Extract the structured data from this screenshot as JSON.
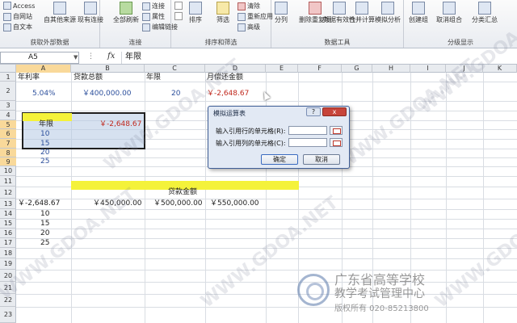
{
  "ribbon": {
    "get_external": {
      "label": "获取外部数据",
      "items": [
        "Access",
        "自网站",
        "自文本",
        "自其他来源",
        "现有连接"
      ]
    },
    "connections": {
      "label": "连接",
      "items": [
        "全部刷新",
        "连接",
        "属性",
        "编辑链接"
      ]
    },
    "sort_filter": {
      "label": "排序和筛选",
      "items": [
        "排序",
        "筛选",
        "清除",
        "重新应用",
        "高级"
      ]
    },
    "data_tools": {
      "label": "数据工具",
      "items": [
        "分列",
        "删除重复项",
        "数据有效性",
        "合并计算",
        "模拟分析"
      ]
    },
    "outline": {
      "label": "分级显示",
      "items": [
        "创建组",
        "取消组合",
        "分类汇总"
      ]
    }
  },
  "formula_bar": {
    "name_box": "A5",
    "fx": "fx",
    "content": "年限"
  },
  "columns": [
    "A",
    "B",
    "C",
    "D",
    "E",
    "F",
    "G",
    "H",
    "I",
    "J",
    "K"
  ],
  "rows": [
    "1",
    "2",
    "3",
    "4",
    "5",
    "6",
    "7",
    "8",
    "9",
    "10",
    "11",
    "12",
    "13",
    "14",
    "15",
    "16",
    "17",
    "18",
    "19",
    "20",
    "21",
    "22",
    "23"
  ],
  "sheet": {
    "a1": "年利率",
    "b1": "贷款总额",
    "c1": "年限",
    "d1": "月偿还金额",
    "a2": "5.04%",
    "b2": "￥400,000.00",
    "c2": "20",
    "d2": "￥-2,648.67",
    "a5": "年限",
    "b5": "￥-2,648.67",
    "a6": "10",
    "a7": "15",
    "a8": "20",
    "a9": "25",
    "c12": "贷款金额",
    "a13": "￥-2,648.67",
    "b13": "￥450,000.00",
    "c13": "￥500,000.00",
    "d13": "￥550,000.00",
    "a14": "10",
    "a15": "15",
    "a16": "20",
    "a17": "25"
  },
  "dialog": {
    "title": "模拟运算表",
    "help": "?",
    "close": "x",
    "row_label": "输入引用行的单元格(R):",
    "col_label": "输入引用列的单元格(C):",
    "ok": "确定",
    "cancel": "取消"
  },
  "watermark": {
    "text": "WWW.GDOA.NET",
    "line1": "广东省高等学校",
    "line2": "教学考试管理中心",
    "line3": "版权所有 020-85213800"
  },
  "colors": {
    "highlight_yellow": "#f4f23a",
    "selection_blue": "#b4c8e4",
    "value_blue": "#2c4f9c",
    "value_red": "#c0281d"
  }
}
